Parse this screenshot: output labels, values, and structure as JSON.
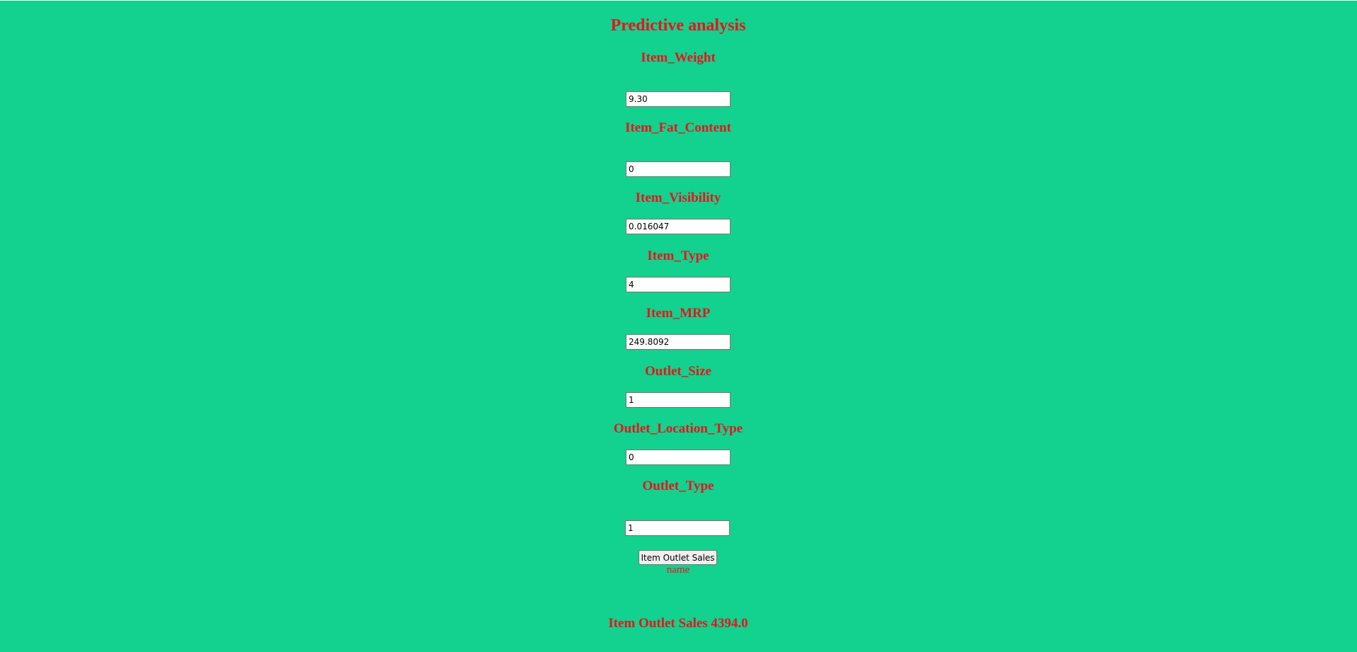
{
  "page": {
    "title": "Predictive analysis",
    "colors": {
      "background": "#13d18f",
      "text": "#e8141b"
    }
  },
  "form": {
    "fields": [
      {
        "label": "Item_Weight",
        "value": "9.30"
      },
      {
        "label": "Item_Fat_Content",
        "value": "0"
      },
      {
        "label": "Item_Visibility",
        "value": "0.016047"
      },
      {
        "label": "Item_Type",
        "value": "4"
      },
      {
        "label": "Item_MRP",
        "value": "249.8092"
      },
      {
        "label": "Outlet_Size",
        "value": "1"
      },
      {
        "label": "Outlet_Location_Type",
        "value": "0"
      },
      {
        "label": "Outlet_Type",
        "value": "1"
      }
    ],
    "submit_label": "Item Outlet Sales",
    "small_label": "name"
  },
  "result": {
    "text": "Item Outlet Sales 4394.0"
  }
}
